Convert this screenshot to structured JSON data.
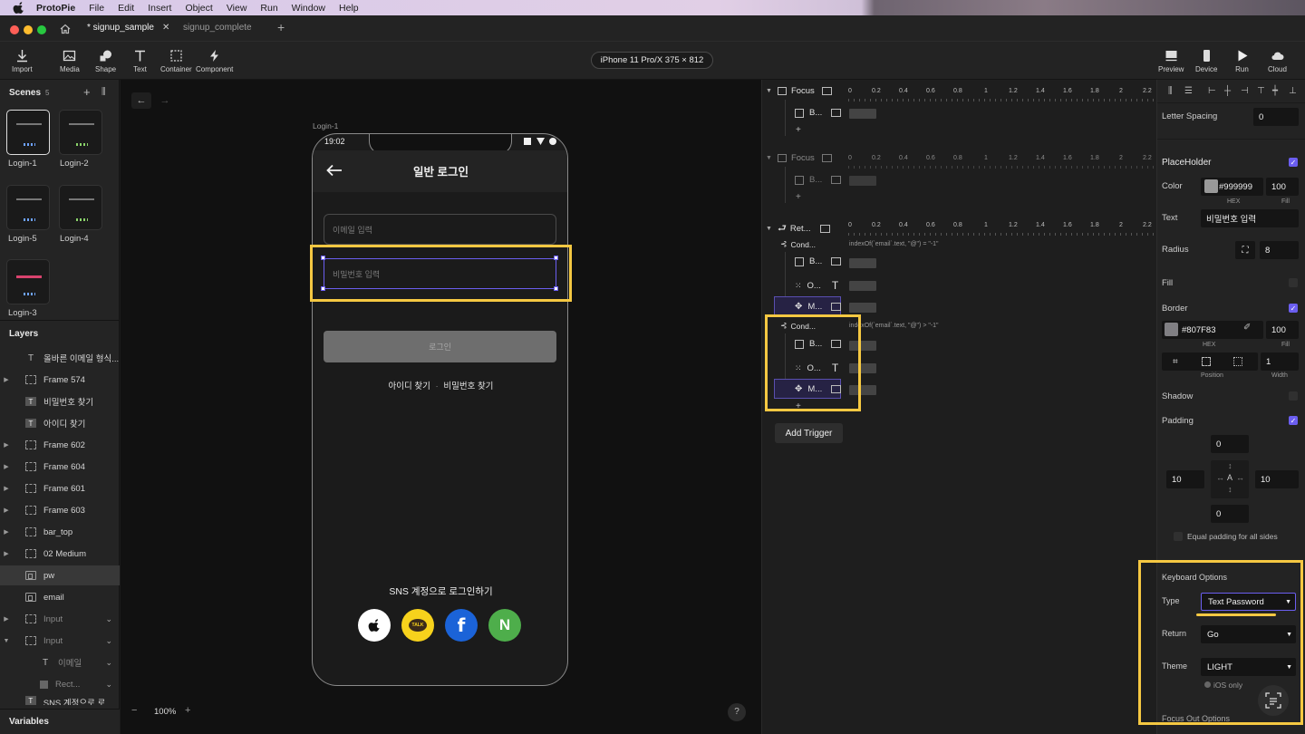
{
  "menubar": {
    "app": "ProtoPie",
    "items": [
      "File",
      "Edit",
      "Insert",
      "Object",
      "View",
      "Run",
      "Window",
      "Help"
    ]
  },
  "tabs": [
    {
      "label": "* signup_sample",
      "active": true
    },
    {
      "label": "signup_complete",
      "active": false
    }
  ],
  "toolbar": {
    "left": [
      "Import",
      "Media",
      "Shape",
      "Text",
      "Container",
      "Component"
    ],
    "device": "iPhone 11 Pro/X  375 × 812",
    "right": [
      "Preview",
      "Device",
      "Run",
      "Cloud"
    ]
  },
  "scenes": {
    "title": "Scenes",
    "count": "5",
    "items": [
      "Login-1",
      "Login-2",
      "Login-5",
      "Login-4",
      "Login-3"
    ]
  },
  "layers": {
    "title": "Layers",
    "items": [
      {
        "label": "올바른 이메일 형식...",
        "icon": "text-icon"
      },
      {
        "label": "Frame 574",
        "icon": "frame-icon"
      },
      {
        "label": "비밀번호 찾기",
        "icon": "text-icon"
      },
      {
        "label": "아이디 찾기",
        "icon": "text-icon"
      },
      {
        "label": "Frame 602",
        "icon": "frame-icon"
      },
      {
        "label": "Frame 604",
        "icon": "frame-icon"
      },
      {
        "label": "Frame 601",
        "icon": "frame-icon"
      },
      {
        "label": "Frame 603",
        "icon": "frame-icon"
      },
      {
        "label": "bar_top",
        "icon": "frame-icon"
      },
      {
        "label": "02 Medium",
        "icon": "frame-icon"
      },
      {
        "label": "pw",
        "icon": "input-icon"
      },
      {
        "label": "email",
        "icon": "input-icon"
      },
      {
        "label": "Input",
        "icon": "frame-icon"
      },
      {
        "label": "Input",
        "icon": "frame-icon"
      },
      {
        "label": "이메일",
        "icon": "text-icon"
      },
      {
        "label": "Rect...",
        "icon": "rect-icon"
      },
      {
        "label": "SNS 계정으로 로그...",
        "icon": "text-icon"
      }
    ]
  },
  "variables": {
    "title": "Variables"
  },
  "canvas": {
    "scene_label": "Login-1",
    "zoom": "100%",
    "help": "?",
    "phone": {
      "time": "19:02",
      "title": "일반 로그인",
      "email_placeholder": "이메일 입력",
      "password_placeholder": "비밀번호 입력",
      "login_button": "로그인",
      "find_id": "아이디 찾기",
      "separator": "·",
      "find_password": "비밀번호 찾기",
      "sns_title": "SNS 계정으로 로그인하기",
      "kakao_label": "TALK",
      "facebook_label": "f",
      "naver_label": "N"
    }
  },
  "interactions": {
    "ruler": [
      "0",
      "0.2",
      "0.4",
      "0.6",
      "0.8",
      "1",
      "1.2",
      "1.4",
      "1.6",
      "1.8",
      "2",
      "2.2"
    ],
    "trigger1": {
      "label": "Focus",
      "response": "B..."
    },
    "trigger2": {
      "label": "Focus",
      "response": "B..."
    },
    "trigger3": {
      "label": "Ret..."
    },
    "cond1": {
      "label": "Cond...",
      "expr": "indexOf(`email`.text, \"@\") = \"-1\""
    },
    "cond1_rows": [
      "B...",
      "O...",
      "M..."
    ],
    "cond2": {
      "label": "Cond...",
      "expr": "indexOf(`email`.text, \"@\") > \"-1\""
    },
    "cond2_rows": [
      "B...",
      "O...",
      "M..."
    ],
    "add": "+",
    "add_trigger": "Add Trigger"
  },
  "props": {
    "letter_spacing": {
      "label": "Letter Spacing",
      "value": "0"
    },
    "placeholder": {
      "label": "PlaceHolder"
    },
    "color": {
      "label": "Color",
      "hex": "#999999",
      "fill": "100",
      "hex_label": "HEX",
      "fill_label": "Fill",
      "swatch": "#999999"
    },
    "text": {
      "label": "Text",
      "value": "비밀번호 입력"
    },
    "radius": {
      "label": "Radius",
      "value": "8"
    },
    "fill": {
      "label": "Fill"
    },
    "border": {
      "label": "Border",
      "hex": "#807F83",
      "fill": "100",
      "hex_label": "HEX",
      "fill_label": "Fill",
      "swatch": "#807F83",
      "position_label": "Position",
      "width_label": "Width",
      "width": "1"
    },
    "shadow": {
      "label": "Shadow"
    },
    "padding": {
      "label": "Padding",
      "top": "0",
      "left": "10",
      "right": "10",
      "bottom": "0",
      "center": "A",
      "equal": "Equal padding for all sides"
    },
    "keyboard": {
      "title": "Keyboard Options",
      "type_label": "Type",
      "type_value": "Text Password",
      "return_label": "Return",
      "return_value": "Go",
      "theme_label": "Theme",
      "theme_value": "LIGHT",
      "ios_only": "iOS only"
    },
    "focus_out": "Focus Out Options"
  },
  "colors": {
    "accent": "#6b5ef0",
    "highlight": "#f5c842",
    "kakao": "#f7d21c",
    "facebook": "#1b63d8",
    "naver": "#4eae4b"
  }
}
